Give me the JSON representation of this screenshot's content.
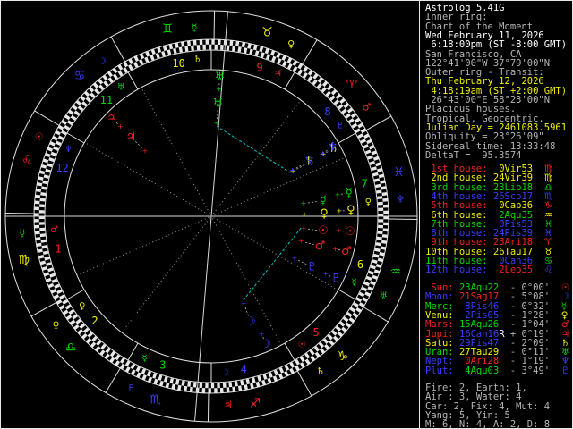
{
  "app_title": "Astrolog 5.41G",
  "colors": {
    "red": "#f22020",
    "yellow": "#efef00",
    "green": "#00d800",
    "blue": "#3b3bff",
    "gray": "#b4b4b4",
    "white": "#ffffff",
    "cyan": "#00c8c8",
    "line": "#e0e0e0",
    "dim_line": "#9a9a9a",
    "background": "#000000"
  },
  "panel": {
    "header_lines": [
      {
        "text": "Astrolog 5.41G",
        "color": "white"
      },
      {
        "text": "Inner ring:",
        "color": "gray"
      },
      {
        "text": "Chart of the Moment",
        "color": "gray"
      },
      {
        "text": "Wed February 11, 2026",
        "color": "white"
      },
      {
        "text": " 6:18:00pm (ST -8:00 GMT)",
        "color": "white"
      },
      {
        "text": "San Francisco, CA",
        "color": "gray"
      },
      {
        "text": "122°41'00\"W 37°79'00\"N",
        "color": "gray"
      },
      {
        "text": "Outer ring - Transit:",
        "color": "gray"
      },
      {
        "text": "Thu February 12, 2026",
        "color": "yellow"
      },
      {
        "text": " 4:18:19am (ST +2:00 GMT)",
        "color": "yellow"
      },
      {
        "text": " 26°43'00\"E 58°23'00\"N",
        "color": "gray"
      },
      {
        "text": "Placidus houses.",
        "color": "gray"
      },
      {
        "text": "Tropical, Geocentric.",
        "color": "gray"
      },
      {
        "text": "Julian Day = 2461083.5961",
        "color": "yellow"
      },
      {
        "text": "Obliquity = 23°26'09\"",
        "color": "gray"
      },
      {
        "text": "Sidereal time: 13:33:48",
        "color": "gray"
      },
      {
        "text": "DeltaT =  95.3574",
        "color": "gray"
      }
    ],
    "house_rows": [
      {
        "label": " 1st house:",
        "value": " 0Vir53",
        "label_color": "red",
        "value_color": "yellow",
        "glyph": "♍",
        "glyph_color": "red"
      },
      {
        "label": " 2nd house:",
        "value": "24Vir39",
        "label_color": "yellow",
        "value_color": "yellow",
        "glyph": "♍",
        "glyph_color": "yellow"
      },
      {
        "label": " 3rd house:",
        "value": "23Lib18",
        "label_color": "green",
        "value_color": "green",
        "glyph": "♎",
        "glyph_color": "green"
      },
      {
        "label": " 4th house:",
        "value": "26Sco17",
        "label_color": "blue",
        "value_color": "blue",
        "glyph": "♏",
        "glyph_color": "blue"
      },
      {
        "label": " 5th house:",
        "value": " 0Cap36",
        "label_color": "red",
        "value_color": "yellow",
        "glyph": "♑",
        "glyph_color": "red"
      },
      {
        "label": " 6th house:",
        "value": " 2Aqu35",
        "label_color": "yellow",
        "value_color": "green",
        "glyph": "♒",
        "glyph_color": "yellow"
      },
      {
        "label": " 7th house:",
        "value": " 0Pis53",
        "label_color": "green",
        "value_color": "blue",
        "glyph": "♓",
        "glyph_color": "green"
      },
      {
        "label": " 8th house:",
        "value": "24Pis39",
        "label_color": "blue",
        "value_color": "blue",
        "glyph": "♓",
        "glyph_color": "blue"
      },
      {
        "label": " 9th house:",
        "value": "23Ari18",
        "label_color": "red",
        "value_color": "red",
        "glyph": "♈",
        "glyph_color": "red"
      },
      {
        "label": "10th house:",
        "value": "26Tau17",
        "label_color": "yellow",
        "value_color": "yellow",
        "glyph": "♉",
        "glyph_color": "yellow"
      },
      {
        "label": "11th house:",
        "value": " 0Can36",
        "label_color": "green",
        "value_color": "blue",
        "glyph": "♋",
        "glyph_color": "green"
      },
      {
        "label": "12th house:",
        "value": " 2Leo35",
        "label_color": "blue",
        "value_color": "red",
        "glyph": "♌",
        "glyph_color": "blue"
      }
    ],
    "planet_rows": [
      {
        "label": " Sun:",
        "value": "23Aqu22",
        "retro": " ",
        "motion": "- 0°00'",
        "label_color": "red",
        "value_color": "green",
        "glyph": "☉",
        "glyph_color": "red"
      },
      {
        "label": "Moon:",
        "value": "21Sag17",
        "retro": " ",
        "motion": "- 5°08'",
        "label_color": "blue",
        "value_color": "red",
        "glyph": "☽",
        "glyph_color": "blue"
      },
      {
        "label": "Merc:",
        "value": " 8Pis46",
        "retro": " ",
        "motion": "- 0°32'",
        "label_color": "green",
        "value_color": "blue",
        "glyph": "☿",
        "glyph_color": "green"
      },
      {
        "label": "Venu:",
        "value": " 2Pis05",
        "retro": " ",
        "motion": "- 1°28'",
        "label_color": "yellow",
        "value_color": "blue",
        "glyph": "♀",
        "glyph_color": "yellow"
      },
      {
        "label": "Mars:",
        "value": "15Aqu26",
        "retro": " ",
        "motion": "- 1°04'",
        "label_color": "red",
        "value_color": "green",
        "glyph": "♂",
        "glyph_color": "red"
      },
      {
        "label": "Jupi:",
        "value": "16Can16",
        "retro": "R",
        "motion": "+ 0°19'",
        "label_color": "red",
        "value_color": "blue",
        "glyph": "♃",
        "glyph_color": "red"
      },
      {
        "label": "Satu:",
        "value": "29Pis47",
        "retro": " ",
        "motion": "- 2°09'",
        "label_color": "yellow",
        "value_color": "blue",
        "glyph": "♄",
        "glyph_color": "yellow"
      },
      {
        "label": "Uran:",
        "value": "27Tau29",
        "retro": " ",
        "motion": "- 0°11'",
        "label_color": "green",
        "value_color": "yellow",
        "glyph": "♅",
        "glyph_color": "green"
      },
      {
        "label": "Nept:",
        "value": " 0Ari28",
        "retro": " ",
        "motion": "- 1°19'",
        "label_color": "blue",
        "value_color": "red",
        "glyph": "♆",
        "glyph_color": "blue"
      },
      {
        "label": "Plut:",
        "value": " 4Aqu03",
        "retro": " ",
        "motion": "- 3°49'",
        "label_color": "blue",
        "value_color": "green",
        "glyph": "♇",
        "glyph_color": "blue"
      }
    ],
    "footer_lines": [
      {
        "text": "Fire: 2, Earth: 1,",
        "color": "gray"
      },
      {
        "text": "Air : 3, Water: 4",
        "color": "gray"
      },
      {
        "text": "Car: 2, Fix: 4, Mut: 4",
        "color": "gray"
      },
      {
        "text": "Yang: 5, Yin: 5",
        "color": "gray"
      },
      {
        "text": "M: 6, N: 4, A: 2, D: 8",
        "color": "gray"
      }
    ]
  },
  "chart_data": {
    "type": "astrology-biwheel",
    "ascendant_lon": 150.883,
    "mc_lon": 56.283,
    "signs": [
      {
        "name": "aries",
        "glyph": "♈",
        "color": "red",
        "ruler_glyph": "♂",
        "ruler_color": "red"
      },
      {
        "name": "taurus",
        "glyph": "♉",
        "color": "yellow",
        "ruler_glyph": "♀",
        "ruler_color": "yellow"
      },
      {
        "name": "gemini",
        "glyph": "♊",
        "color": "green",
        "ruler_glyph": "☿",
        "ruler_color": "green"
      },
      {
        "name": "cancer",
        "glyph": "♋",
        "color": "blue",
        "ruler_glyph": "☽",
        "ruler_color": "blue"
      },
      {
        "name": "leo",
        "glyph": "♌",
        "color": "red",
        "ruler_glyph": "☉",
        "ruler_color": "red"
      },
      {
        "name": "virgo",
        "glyph": "♍",
        "color": "yellow",
        "ruler_glyph": "☿",
        "ruler_color": "green"
      },
      {
        "name": "libra",
        "glyph": "♎",
        "color": "green",
        "ruler_glyph": "♀",
        "ruler_color": "yellow"
      },
      {
        "name": "scorpio",
        "glyph": "♏",
        "color": "blue",
        "ruler_glyph": "♇",
        "ruler_color": "blue"
      },
      {
        "name": "sagittarius",
        "glyph": "♐",
        "color": "red",
        "ruler_glyph": "♃",
        "ruler_color": "red"
      },
      {
        "name": "capricorn",
        "glyph": "♑",
        "color": "yellow",
        "ruler_glyph": "♄",
        "ruler_color": "yellow"
      },
      {
        "name": "aquarius",
        "glyph": "♒",
        "color": "green",
        "ruler_glyph": "♅",
        "ruler_color": "green"
      },
      {
        "name": "pisces",
        "glyph": "♓",
        "color": "blue",
        "ruler_glyph": "♆",
        "ruler_color": "blue"
      }
    ],
    "houses": [
      {
        "num": "1",
        "color": "red",
        "ruler_glyph": "♂",
        "ruler_color": "red"
      },
      {
        "num": "2",
        "color": "yellow",
        "ruler_glyph": "♀",
        "ruler_color": "yellow"
      },
      {
        "num": "3",
        "color": "green",
        "ruler_glyph": "☿",
        "ruler_color": "green"
      },
      {
        "num": "4",
        "color": "blue",
        "ruler_glyph": "☽",
        "ruler_color": "blue"
      },
      {
        "num": "5",
        "color": "red",
        "ruler_glyph": "☉",
        "ruler_color": "red"
      },
      {
        "num": "6",
        "color": "yellow",
        "ruler_glyph": "☿",
        "ruler_color": "green"
      },
      {
        "num": "7",
        "color": "green",
        "ruler_glyph": "♀",
        "ruler_color": "yellow"
      },
      {
        "num": "8",
        "color": "blue",
        "ruler_glyph": "♇",
        "ruler_color": "blue"
      },
      {
        "num": "9",
        "color": "red",
        "ruler_glyph": "♃",
        "ruler_color": "red"
      },
      {
        "num": "10",
        "color": "yellow",
        "ruler_glyph": "♄",
        "ruler_color": "yellow"
      },
      {
        "num": "11",
        "color": "green",
        "ruler_glyph": "♅",
        "ruler_color": "green"
      },
      {
        "num": "12",
        "color": "blue",
        "ruler_glyph": "♆",
        "ruler_color": "blue"
      }
    ],
    "planets": [
      {
        "name": "sun",
        "glyph": "☉",
        "color": "red",
        "natal_lon": 323.367,
        "transit_lon": 324.4
      },
      {
        "name": "moon",
        "glyph": "☽",
        "color": "blue",
        "natal_lon": 261.283,
        "transit_lon": 264.0
      },
      {
        "name": "mercury",
        "glyph": "☿",
        "color": "green",
        "natal_lon": 338.767,
        "transit_lon": 340.55
      },
      {
        "name": "venus",
        "glyph": "♀",
        "color": "yellow",
        "natal_lon": 332.083,
        "transit_lon": 333.3
      },
      {
        "name": "mars",
        "glyph": "♂",
        "color": "red",
        "natal_lon": 315.433,
        "transit_lon": 316.15
      },
      {
        "name": "jupiter",
        "glyph": "♃",
        "color": "red",
        "natal_lon": 106.267,
        "transit_lon": 106.2
      },
      {
        "name": "saturn",
        "glyph": "♄",
        "color": "yellow",
        "natal_lon": 359.783,
        "transit_lon": 359.9
      },
      {
        "name": "uranus",
        "glyph": "♅",
        "color": "green",
        "natal_lon": 57.483,
        "transit_lon": 57.42
      },
      {
        "name": "neptune",
        "glyph": "♆",
        "color": "blue",
        "natal_lon": 0.467,
        "transit_lon": 0.52
      },
      {
        "name": "pluto",
        "glyph": "♇",
        "color": "blue",
        "natal_lon": 304.05,
        "transit_lon": 304.12
      }
    ],
    "aspect_lines": [
      {
        "a": "uranus",
        "b": "saturn",
        "color": "cyan"
      },
      {
        "a": "sun",
        "b": "moon",
        "color": "cyan"
      }
    ],
    "cusp_axes_solid_lon": [
      150.883,
      56.283
    ],
    "cusp_lines_dotted_lon": [
      174.65,
      203.3,
      269.4,
      300.6
    ]
  }
}
